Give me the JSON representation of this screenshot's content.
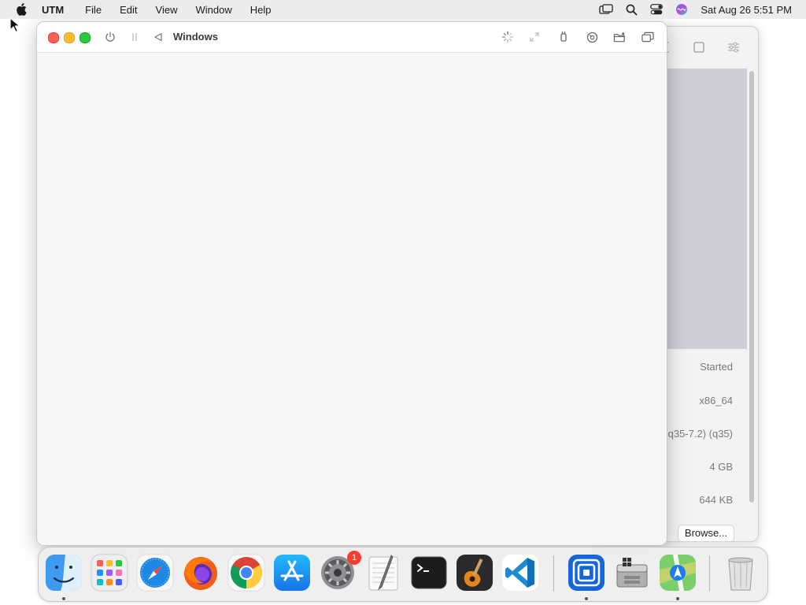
{
  "menubar": {
    "app_name": "UTM",
    "items": [
      "File",
      "Edit",
      "View",
      "Window",
      "Help"
    ],
    "clock": "Sat Aug 26  5:51 PM",
    "status_icons": [
      "screen-mirroring-icon",
      "spotlight-search-icon",
      "control-center-icon",
      "siri-icon"
    ]
  },
  "vm_window": {
    "title": "Windows",
    "toolbar_left": [
      "power-icon",
      "pause-icon",
      "restart-icon"
    ],
    "toolbar_right": [
      "display-spinner-icon",
      "resize-icon",
      "usb-icon",
      "drive-icon",
      "shared-folder-icon",
      "windows-icon"
    ]
  },
  "background_window": {
    "info_values": [
      "Started",
      "x86_64",
      "(q35-7.2) (q35)",
      "4 GB",
      "644 KB"
    ],
    "browse_label": "Browse..."
  },
  "dock": {
    "apps": [
      {
        "name": "finder-icon",
        "running": true
      },
      {
        "name": "launchpad-icon",
        "running": false
      },
      {
        "name": "safari-icon",
        "running": false
      },
      {
        "name": "firefox-icon",
        "running": false
      },
      {
        "name": "chrome-icon",
        "running": false
      },
      {
        "name": "app-store-icon",
        "running": false
      },
      {
        "name": "system-settings-icon",
        "running": false,
        "badge": "1"
      },
      {
        "name": "textedit-icon",
        "running": false
      },
      {
        "name": "terminal-icon",
        "running": false
      },
      {
        "name": "garageband-icon",
        "running": false
      },
      {
        "name": "vscode-icon",
        "running": false
      },
      {
        "name": "utm-icon",
        "running": true
      },
      {
        "name": "boot-camp-assistant-icon",
        "running": false
      },
      {
        "name": "maps-icon",
        "running": true
      },
      {
        "name": "trash-icon",
        "running": false
      }
    ]
  },
  "colors": {
    "close": "#ff5f57",
    "minimize": "#febc2e",
    "zoom": "#28c840",
    "badge": "#ff3b30"
  }
}
